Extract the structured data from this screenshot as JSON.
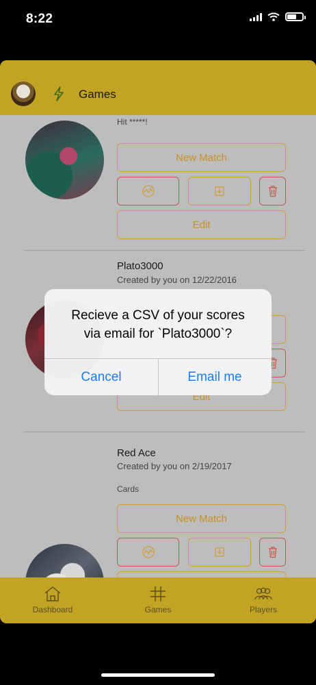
{
  "status_bar": {
    "time": "8:22"
  },
  "header": {
    "title": "Games"
  },
  "games": [
    {
      "desc": "Hit *****!",
      "new_match": "New Match",
      "edit": "Edit"
    },
    {
      "title": "Plato3000",
      "sub": "Created by you on 12/22/2016",
      "edit": "Edit"
    },
    {
      "title": "Red Ace",
      "sub": "Created by you on 2/19/2017",
      "desc": "Cards",
      "new_match": "New Match"
    }
  ],
  "dialog": {
    "line1": "Recieve a CSV of your scores",
    "line2": "via email for `Plato3000`?",
    "cancel": "Cancel",
    "confirm": "Email me"
  },
  "tabbar": {
    "items": [
      {
        "label": "Dashboard",
        "icon": "home-icon"
      },
      {
        "label": "Games",
        "icon": "hash-icon"
      },
      {
        "label": "Players",
        "icon": "players-icon"
      }
    ]
  },
  "colors": {
    "accent": "#c2a323",
    "button_border": "#d49b36",
    "danger": "#c9544a",
    "link": "#1a7cf2"
  }
}
